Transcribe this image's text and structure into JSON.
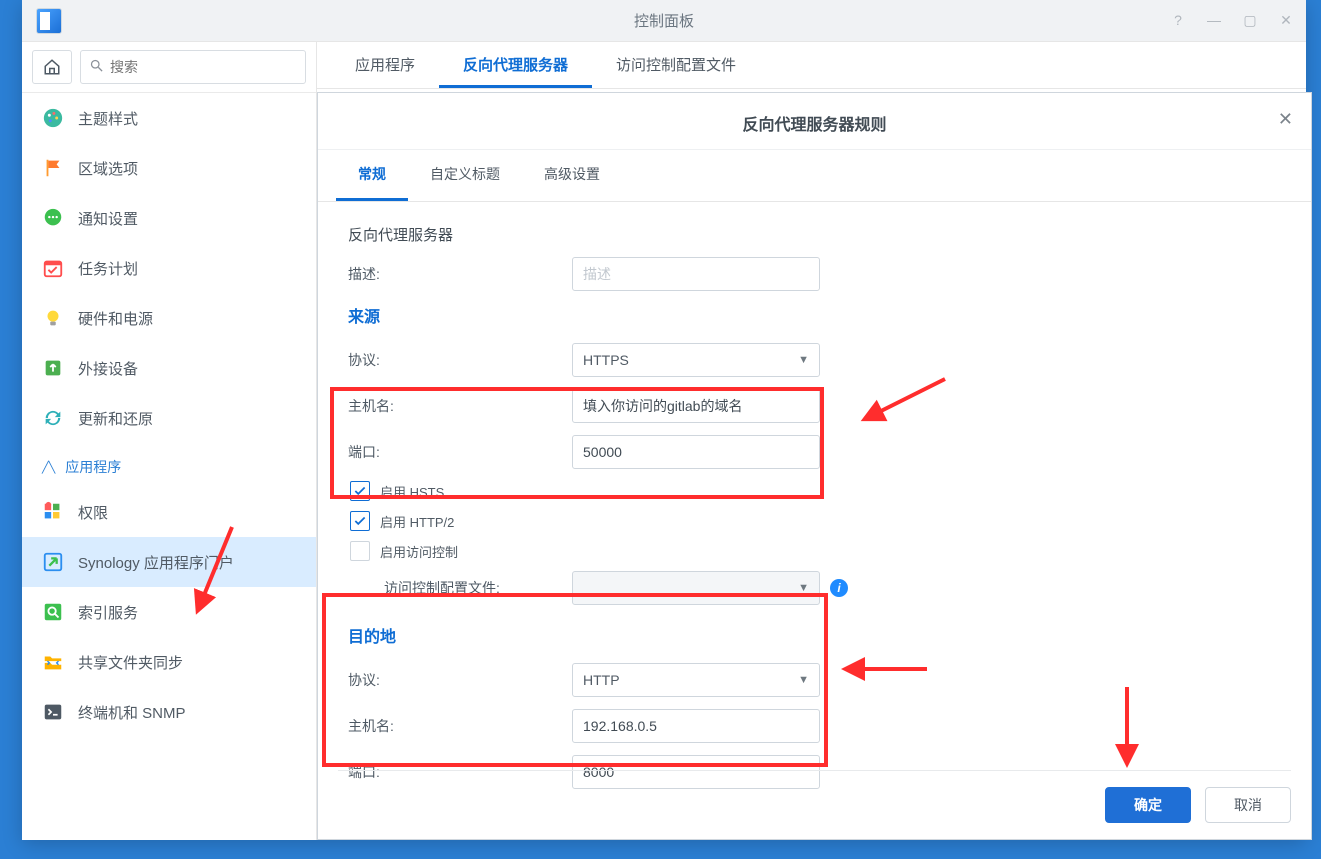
{
  "window": {
    "title": "控制面板"
  },
  "sidebar": {
    "search_placeholder": "搜索",
    "items": [
      {
        "label": "主题样式"
      },
      {
        "label": "区域选项"
      },
      {
        "label": "通知设置"
      },
      {
        "label": "任务计划"
      },
      {
        "label": "硬件和电源"
      },
      {
        "label": "外接设备"
      },
      {
        "label": "更新和还原"
      }
    ],
    "group_label": "应用程序",
    "group_items": [
      {
        "label": "权限"
      },
      {
        "label": "Synology 应用程序门户"
      },
      {
        "label": "索引服务"
      },
      {
        "label": "共享文件夹同步"
      },
      {
        "label": "终端机和 SNMP"
      }
    ]
  },
  "content_tabs": [
    {
      "label": "应用程序"
    },
    {
      "label": "反向代理服务器"
    },
    {
      "label": "访问控制配置文件"
    }
  ],
  "modal": {
    "title": "反向代理服务器规则",
    "tabs": [
      {
        "label": "常规"
      },
      {
        "label": "自定义标题"
      },
      {
        "label": "高级设置"
      }
    ],
    "section_header": "反向代理服务器",
    "labels": {
      "description": "描述:",
      "description_ph": "描述",
      "source_title": "来源",
      "protocol": "协议:",
      "hostname": "主机名:",
      "port": "端口:",
      "hsts": "启用 HSTS",
      "http2": "启用 HTTP/2",
      "access_control": "启用访问控制",
      "access_profile": "访问控制配置文件:",
      "dest_title": "目的地"
    },
    "source": {
      "protocol": "HTTPS",
      "hostname": "填入你访问的gitlab的域名",
      "port": "50000"
    },
    "destination": {
      "protocol": "HTTP",
      "hostname": "192.168.0.5",
      "port": "8000"
    },
    "buttons": {
      "ok": "确定",
      "cancel": "取消"
    }
  }
}
